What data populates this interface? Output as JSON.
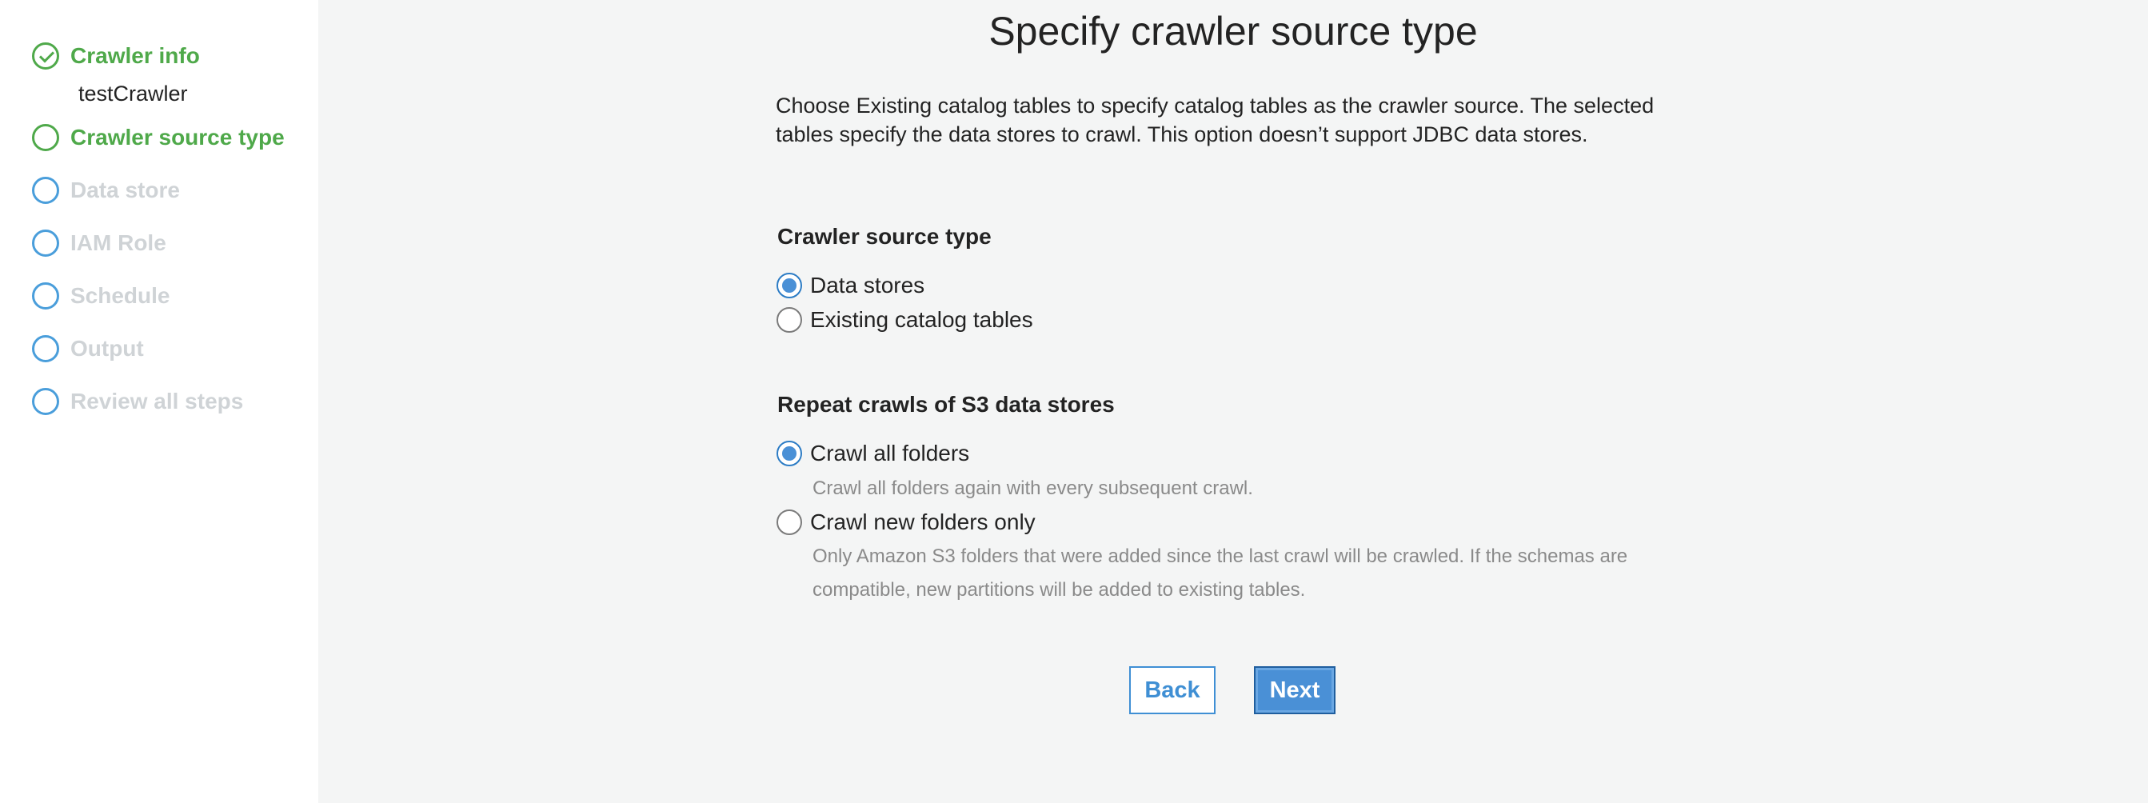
{
  "sidebar": {
    "steps": [
      {
        "label": "Crawler info",
        "state": "completed",
        "icon": "check-circle-icon"
      },
      {
        "label": "Crawler source type",
        "state": "current",
        "icon": "circle-icon"
      },
      {
        "label": "Data store",
        "state": "pending",
        "icon": "circle-icon"
      },
      {
        "label": "IAM Role",
        "state": "pending",
        "icon": "circle-icon"
      },
      {
        "label": "Schedule",
        "state": "pending",
        "icon": "circle-icon"
      },
      {
        "label": "Output",
        "state": "pending",
        "icon": "circle-icon"
      },
      {
        "label": "Review all steps",
        "state": "pending",
        "icon": "circle-icon"
      }
    ],
    "crawler_name": "testCrawler"
  },
  "main": {
    "title": "Specify crawler source type",
    "intro": "Choose Existing catalog tables to specify catalog tables as the crawler source. The selected tables specify the data stores to crawl. This option doesn’t support JDBC data stores.",
    "source_type": {
      "heading": "Crawler source type",
      "options": [
        {
          "label": "Data stores",
          "checked": true
        },
        {
          "label": "Existing catalog tables",
          "checked": false
        }
      ]
    },
    "repeat_crawls": {
      "heading": "Repeat crawls of S3 data stores",
      "options": [
        {
          "label": "Crawl all folders",
          "checked": true,
          "hint": "Crawl all folders again with every subsequent crawl."
        },
        {
          "label": "Crawl new folders only",
          "checked": false,
          "hint": "Only Amazon S3 folders that were added since the last crawl will be crawled. If the schemas are compatible, new partitions will be added to existing tables."
        }
      ]
    },
    "buttons": {
      "back": "Back",
      "next": "Next"
    }
  },
  "colors": {
    "completed_green": "#4fa94a",
    "pending_blue": "#4a9edb",
    "pending_text": "#cfd3d6",
    "accent_blue": "#4a90d6",
    "background": "#f4f5f5"
  }
}
